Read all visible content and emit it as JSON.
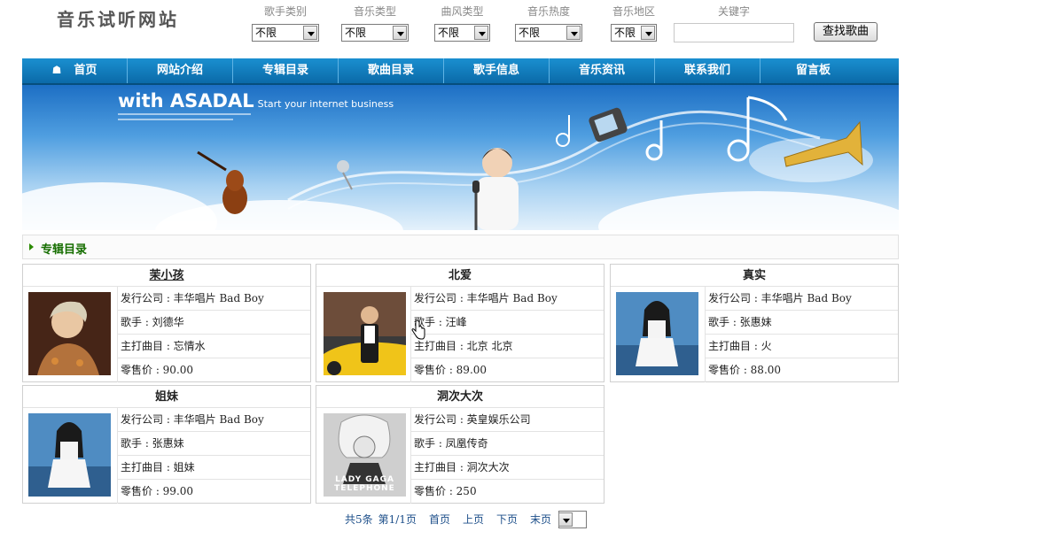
{
  "site": {
    "title": "音乐试听网站"
  },
  "filters": [
    {
      "label": "歌手类别",
      "value": "不限"
    },
    {
      "label": "音乐类型",
      "value": "不限"
    },
    {
      "label": "曲风类型",
      "value": "不限"
    },
    {
      "label": "音乐热度",
      "value": "不限"
    },
    {
      "label": "音乐地区",
      "value": "不限"
    }
  ],
  "keyword": {
    "label": "关键字",
    "value": ""
  },
  "search_button": "查找歌曲",
  "nav": [
    "首页",
    "网站介绍",
    "专辑目录",
    "歌曲目录",
    "歌手信息",
    "音乐资讯",
    "联系我们",
    "留言板"
  ],
  "banner": {
    "title": "with ASADAL",
    "subtitle": "Start your internet business"
  },
  "section": {
    "title": "专辑目录"
  },
  "albums": [
    {
      "title": "茉小孩",
      "company": "发行公司 : 丰华唱片 Bad Boy",
      "singer": "歌手 : 刘德华",
      "song": "主打曲目 : 忘情水",
      "price": "零售价 : 90.00"
    },
    {
      "title": "北爱",
      "company": "发行公司 : 丰华唱片 Bad Boy",
      "singer": "歌手 : 汪峰",
      "song": "主打曲目 : 北京 北京",
      "price": "零售价 : 89.00"
    },
    {
      "title": "真实",
      "company": "发行公司 : 丰华唱片 Bad Boy",
      "singer": "歌手 : 张惠妹",
      "song": "主打曲目 : 火",
      "price": "零售价 : 88.00"
    },
    {
      "title": "姐妹",
      "company": "发行公司 : 丰华唱片 Bad Boy",
      "singer": "歌手 : 张惠妹",
      "song": "主打曲目 : 姐妹",
      "price": "零售价 : 99.00"
    },
    {
      "title": "洞次大次",
      "company": "发行公司 : 英皇娱乐公司",
      "singer": "歌手 : 凤凰传奇",
      "song": "主打曲目 : 洞次大次",
      "price": "零售价 : 250",
      "cover_text": "LADY GAGA TELEPHONE"
    }
  ],
  "pager": {
    "total": "共5条",
    "page": "第1/1页",
    "first": "首页",
    "prev": "上页",
    "next": "下页",
    "last": "末页",
    "current": "1"
  },
  "colors": {
    "nav": "#0b6aa8",
    "section_title": "#166e00",
    "pager_link": "#1d4f8a"
  }
}
